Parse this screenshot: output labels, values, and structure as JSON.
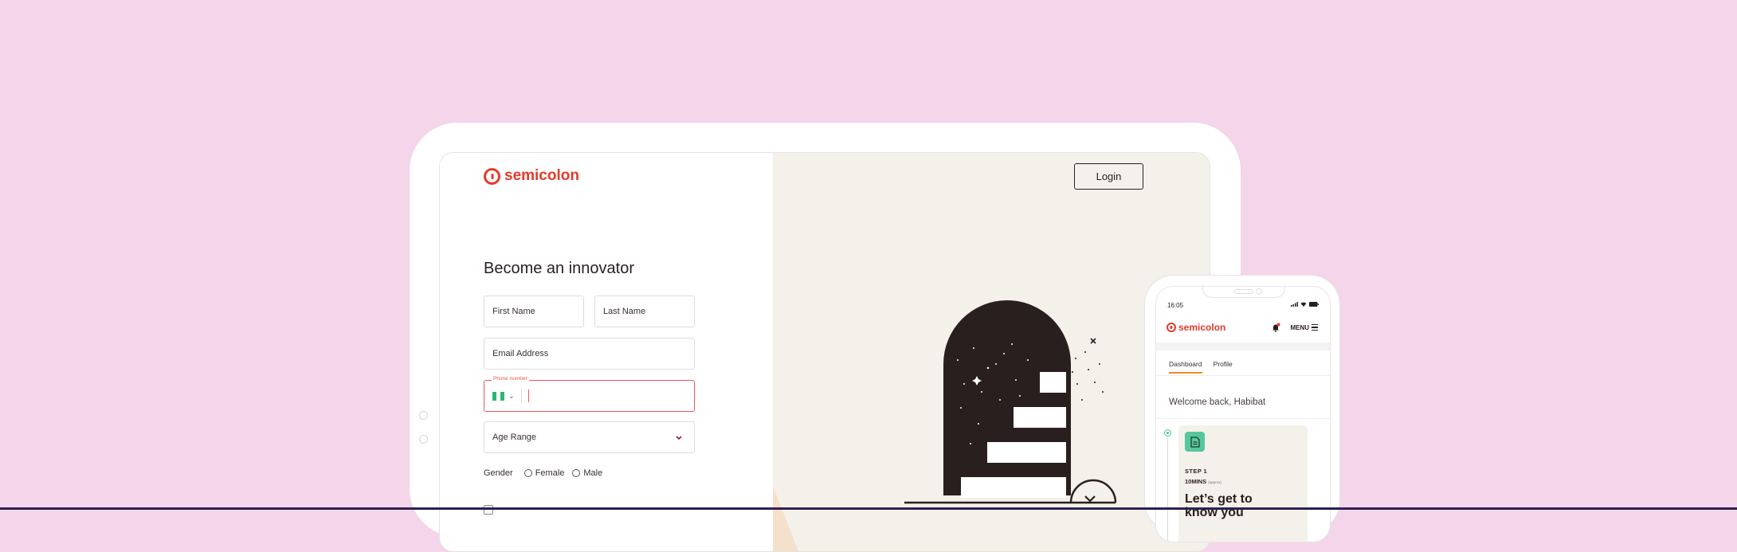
{
  "colors": {
    "page_background": "#f5d5e9",
    "brand_red": "#e53a2b",
    "illustration_dark": "#2a1f1f",
    "error_red": "#e8575b",
    "accent_orange": "#f08a24",
    "success_green": "#55c79c",
    "right_pane_background": "#f4f0ea"
  },
  "tablet": {
    "brand": "semicolon",
    "login_label": "Login",
    "form": {
      "title": "Become an innovator",
      "first_name_placeholder": "First Name",
      "last_name_placeholder": "Last Name",
      "email_placeholder": "Email Address",
      "phone_label": "Phone number",
      "phone_value": "",
      "age_range_label": "Age Range",
      "gender_label": "Gender",
      "gender_options": [
        "Female",
        "Male"
      ]
    }
  },
  "phone": {
    "time": "16:05",
    "brand": "semicolon",
    "menu_label": "MENU",
    "tabs": [
      {
        "label": "Dashboard",
        "active": true
      },
      {
        "label": "Profile",
        "active": false
      }
    ],
    "welcome": "Welcome back, Habibat",
    "card": {
      "step": "STEP 1",
      "duration": "10MINS",
      "duration_note": "(approx)",
      "title": "Let’s get to know you"
    }
  }
}
